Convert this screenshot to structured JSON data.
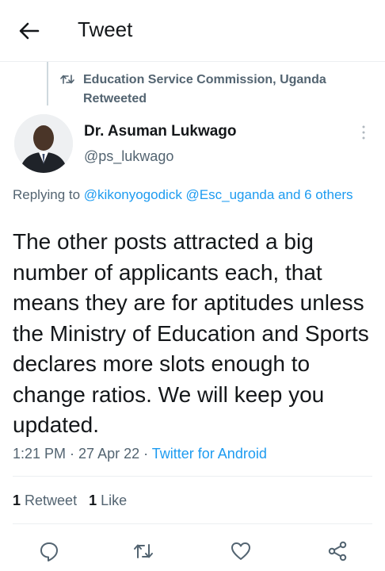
{
  "header": {
    "title": "Tweet",
    "back_icon": "arrow-left-icon"
  },
  "retweet_context": {
    "icon": "retweet-icon",
    "text": "Education Service Commission, Uganda Retweeted"
  },
  "author": {
    "name": "Dr. Asuman Lukwago",
    "handle": "@ps_lukwago"
  },
  "reply_to": {
    "prefix": "Replying to ",
    "mentions": "@kikonyogodick @Esc_uganda and 6 others"
  },
  "tweet": {
    "text": "The other posts attracted a big number of applicants each, that means they are for aptitudes unless the Ministry of Education and Sports declares more slots enough to change ratios. We will keep you updated."
  },
  "meta": {
    "time": "1:21 PM",
    "sep1": " · ",
    "date": "27 Apr 22",
    "sep2": " · ",
    "source": "Twitter for Android"
  },
  "stats": {
    "retweets_count": "1",
    "retweets_label": "Retweet",
    "likes_count": "1",
    "likes_label": "Like"
  },
  "actions": [
    "reply-icon",
    "retweet-icon",
    "like-icon",
    "share-icon"
  ],
  "colors": {
    "link": "#1d9bf0",
    "secondary": "#536471",
    "text": "#14171a"
  }
}
